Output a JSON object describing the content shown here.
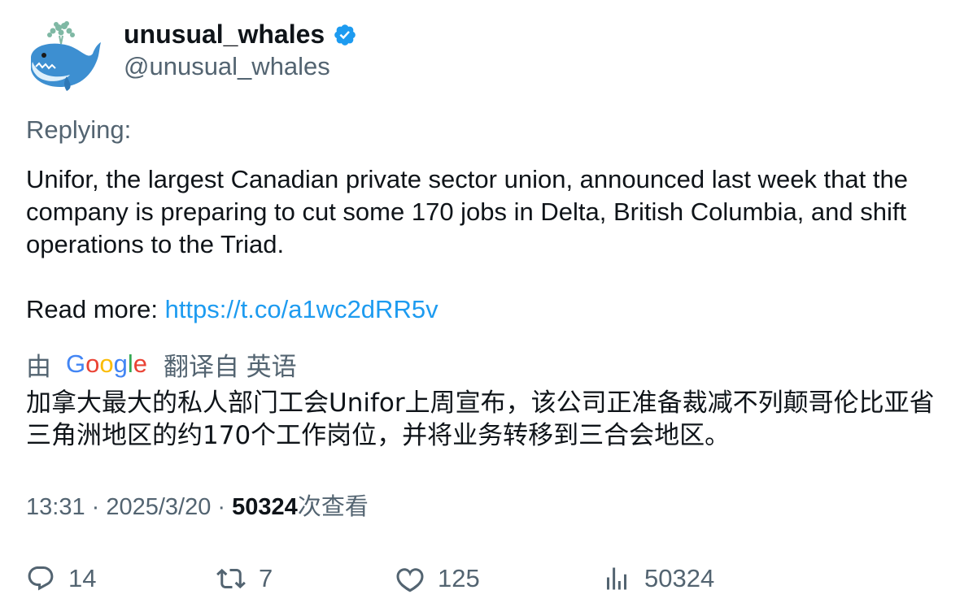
{
  "author": {
    "name": "unusual_whales",
    "handle": "@unusual_whales",
    "avatar_icon": "whale-avatar",
    "verified_color": "#1d9bf0"
  },
  "tweet": {
    "replying_label": "Replying:",
    "text": "Unifor, the largest Canadian private sector union, announced last week that the company is preparing to cut some 170 jobs in Delta, British Columbia, and shift operations to the Triad.",
    "read_more_label": "Read more: ",
    "link": "https://t.co/a1wc2dRR5v"
  },
  "translation": {
    "prefix": "由",
    "provider": "Google",
    "suffix": "翻译自 英语",
    "text": "加拿大最大的私人部门工会Unifor上周宣布，该公司正准备裁减不列颠哥伦比亚省三角洲地区的约170个工作岗位，并将业务转移到三合会地区。"
  },
  "meta": {
    "time": "13:31",
    "separator": " · ",
    "date": "2025/3/20",
    "views": "50324",
    "views_label": "次查看"
  },
  "actions": {
    "replies": "14",
    "retweets": "7",
    "likes": "125",
    "views": "50324"
  },
  "colors": {
    "link": "#1d9bf0",
    "muted": "#536471",
    "text": "#0f1419"
  }
}
